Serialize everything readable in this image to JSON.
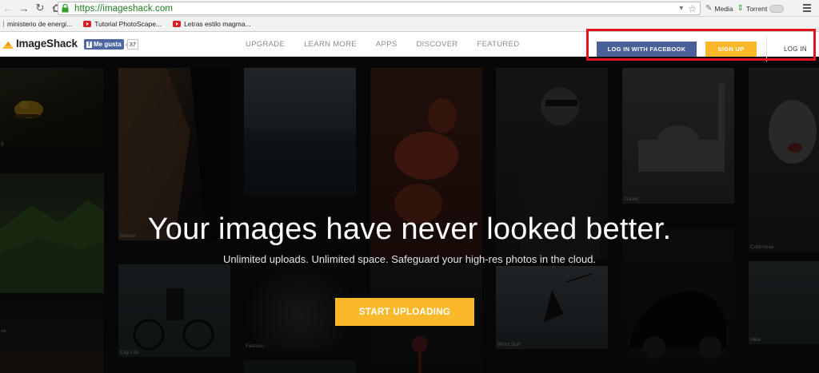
{
  "browser": {
    "url": "https://imageshack.com",
    "bookmarks": [
      {
        "label": "ministerio de energi...",
        "icon": "bookmark-bullet-icon"
      },
      {
        "label": "Tutorial PhotoScape...",
        "icon": "youtube-icon"
      },
      {
        "label": "Letras estilo magma...",
        "icon": "youtube-icon"
      }
    ],
    "extensions": [
      {
        "label": "Media",
        "icon": "media-icon"
      },
      {
        "label": "Torrent",
        "icon": "torrent-icon"
      }
    ]
  },
  "site": {
    "brand": "ImageShack",
    "facebook_like": {
      "label": "Me gusta",
      "count": "37"
    },
    "nav": [
      "UPGRADE",
      "LEARN MORE",
      "APPS",
      "DISCOVER",
      "FEATURED"
    ],
    "actions": {
      "facebook_login": "LOG IN WITH FACEBOOK",
      "signup": "SIGN UP",
      "login": "LOG IN"
    }
  },
  "hero": {
    "title": "Your images have never looked better.",
    "subtitle": "Unlimited uploads. Unlimited space. Safeguard your high-res photos in the cloud.",
    "cta": "START UPLOADING"
  },
  "gallery": {
    "captions": [
      "Nature",
      "Fashion",
      "City Life",
      "Wind Surf",
      "Travel",
      "Cold nose",
      "Hike"
    ]
  },
  "colors": {
    "accent_yellow": "#fbb82b",
    "facebook_blue": "#4a6098",
    "highlight_red": "#e3141b",
    "url_green": "#1b7c1b"
  }
}
